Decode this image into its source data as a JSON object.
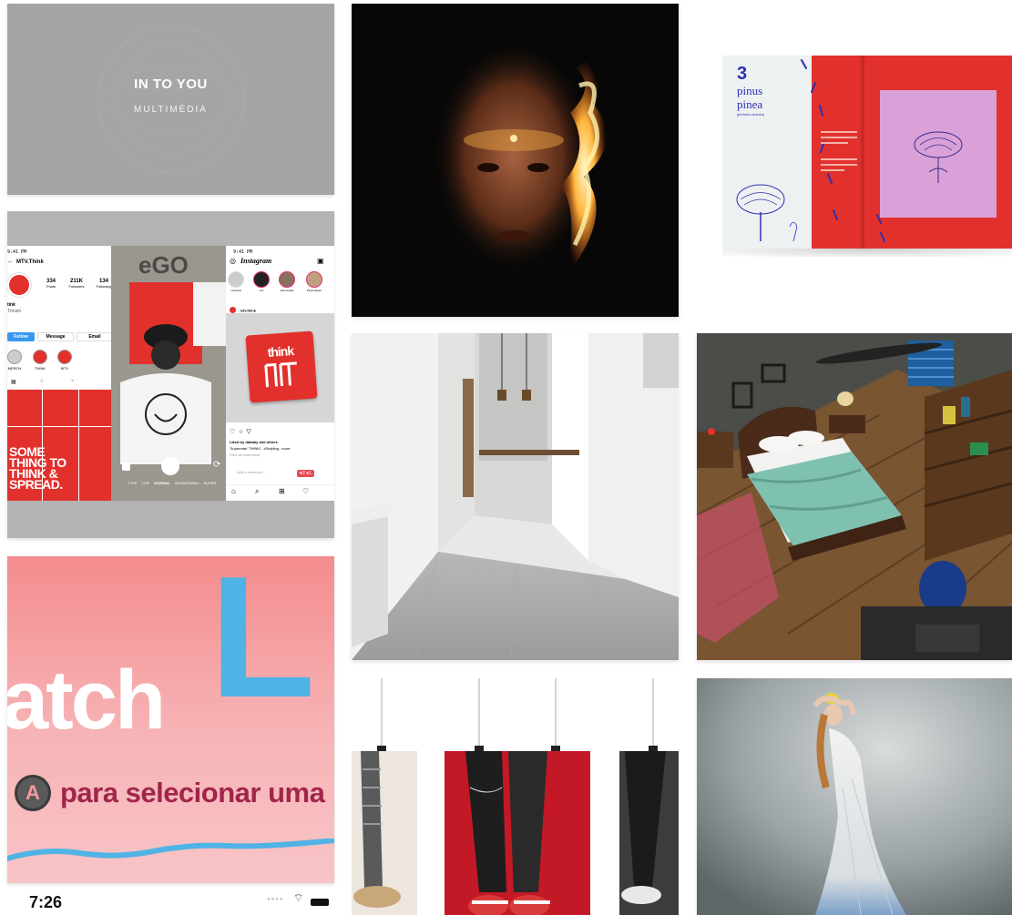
{
  "gallery": {
    "tiles": [
      {
        "id": "into-you",
        "title": "IN TO YOU",
        "subtitle": "MULTIMÉDIA"
      },
      {
        "id": "fire-portrait"
      },
      {
        "id": "pinus-pinea-book",
        "number": "3",
        "title_line1": "pinus",
        "title_line2": "pinea",
        "latin": "(pinheiro-manso)"
      },
      {
        "id": "mtv-think",
        "profile": {
          "time": "9:41 PM",
          "username": "MTV.Think",
          "stats": [
            {
              "value": "334",
              "label": "Posts"
            },
            {
              "value": "211K",
              "label": "Followers"
            },
            {
              "value": "134",
              "label": "Following"
            }
          ],
          "name": "tink",
          "bio": "Tricam",
          "buttons": [
            "Follow",
            "Message",
            "Email"
          ],
          "highlights": [
            "MERCH",
            "THINK",
            "MTV"
          ],
          "grid_text": [
            "SOME",
            "THING TO",
            "THINK &",
            "SPREAD."
          ]
        },
        "camera": {
          "modes": [
            "TYPE",
            "LIVE",
            "NORMAL",
            "BOOMERANG",
            "SUPER"
          ]
        },
        "feed": {
          "time": "9:41 PM",
          "app": "Instagram",
          "stories": [
            "mtv.think",
            "mtv",
            "alexmusikk",
            "Pixelmakare"
          ],
          "post_user": "mtv.think",
          "logo_word": "think",
          "likes": "Liked by dababy and others",
          "caption": "'Superman' THINK!.. #Safyling.. more",
          "view_comments": "View all comments",
          "add_comment": "Add a comment...",
          "notif": "♥2  ●1"
        }
      },
      {
        "id": "hallway-render"
      },
      {
        "id": "bedroom-3d"
      },
      {
        "id": "catch-l",
        "big_text": "atch",
        "big_letter": "L",
        "instruction": "para selecionar uma",
        "button_letter": "A",
        "status_time": "7:26"
      },
      {
        "id": "posters"
      },
      {
        "id": "dancer-photo"
      }
    ]
  },
  "colors": {
    "grey_tile": "#a5a5a5",
    "red": "#e2312d",
    "instagram_blue": "#3897f0",
    "pink": "#f59a9c",
    "sky_blue": "#4fb3e6"
  }
}
